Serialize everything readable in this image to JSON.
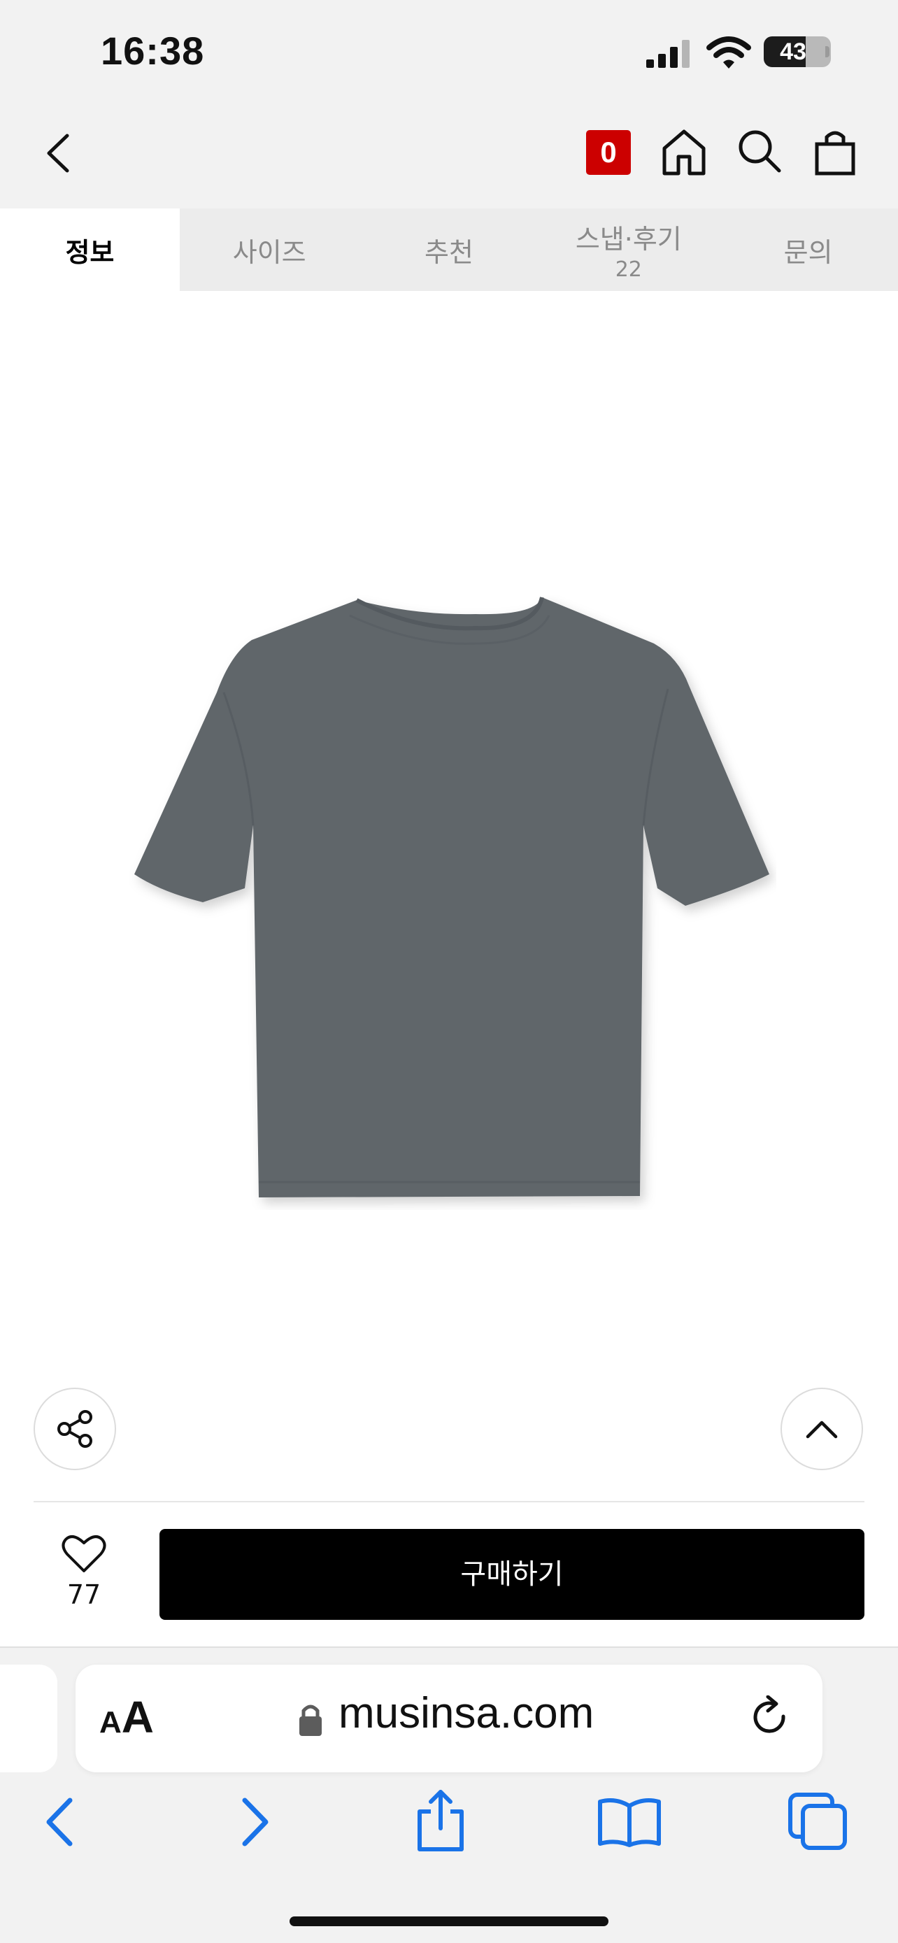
{
  "status_bar": {
    "time": "16:38",
    "battery_level": "43",
    "icons": [
      "cellular-signal-icon",
      "wifi-icon",
      "battery-icon"
    ]
  },
  "header": {
    "back_icon": "chevron-left-icon",
    "brand_badge": "0",
    "icons": [
      "home-icon",
      "search-icon",
      "shopping-bag-icon"
    ]
  },
  "tabs": [
    {
      "label": "정보",
      "active": true
    },
    {
      "label": "사이즈",
      "active": false
    },
    {
      "label": "추천",
      "active": false
    },
    {
      "label": "스냅·후기",
      "count": "22",
      "active": false
    },
    {
      "label": "문의",
      "active": false
    }
  ],
  "product": {
    "image": "grey-tshirt-back-view",
    "color": "#60666b"
  },
  "floating": {
    "share_icon": "share-icon",
    "scroll_top_icon": "chevron-up-icon"
  },
  "purchase_bar": {
    "like_count": "77",
    "buy_label": "구매하기"
  },
  "safari": {
    "text_size_label_small": "A",
    "text_size_label_large": "A",
    "url": "musinsa.com",
    "toolbar_icons": [
      "back-icon",
      "forward-icon",
      "share-icon",
      "bookmarks-icon",
      "tabs-icon"
    ],
    "accent_color": "#1a73e8"
  }
}
